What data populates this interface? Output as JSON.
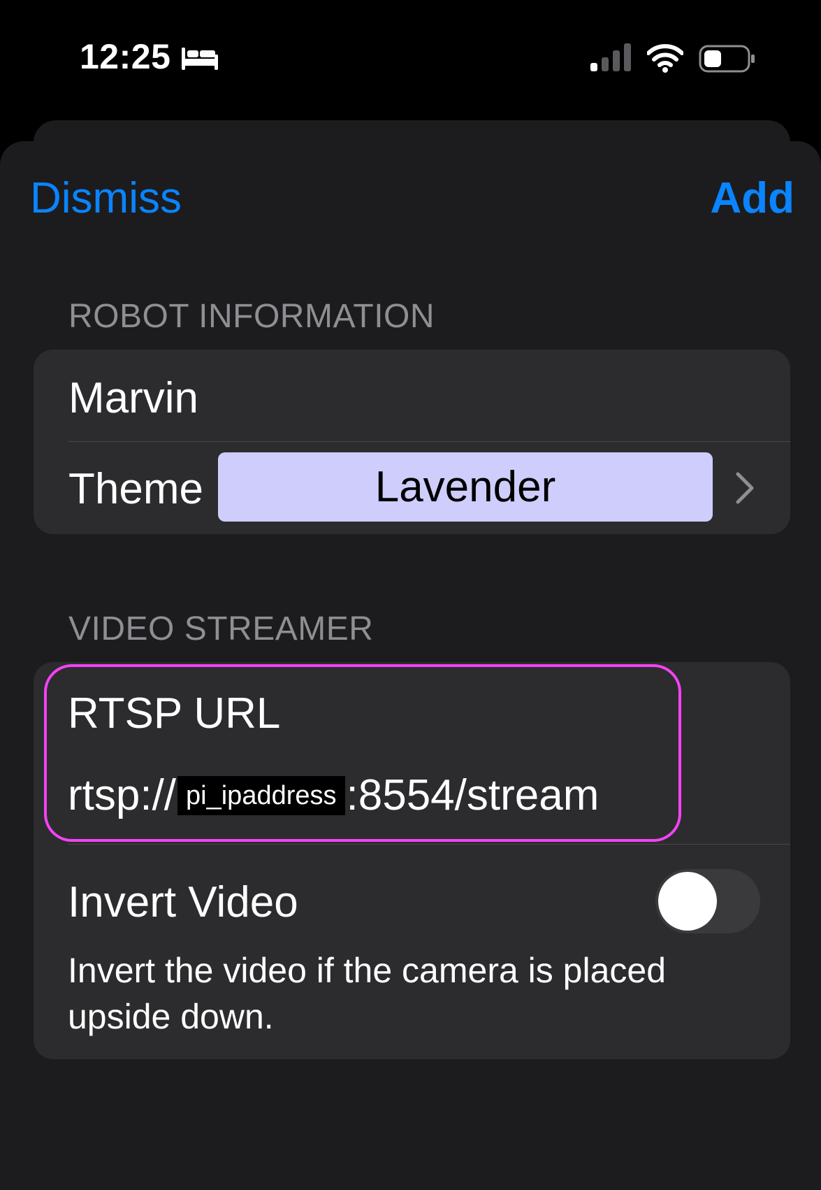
{
  "status_bar": {
    "time": "12:25",
    "focus_icon": "bed-icon",
    "signal_icon": "signal-icon",
    "wifi_icon": "wifi-icon",
    "battery_icon": "battery-icon"
  },
  "nav": {
    "dismiss_label": "Dismiss",
    "add_label": "Add",
    "accent_color": "#0a84ff"
  },
  "robot_information": {
    "header": "ROBOT INFORMATION",
    "name_value": "Marvin",
    "theme_label": "Theme",
    "theme_value": "Lavender",
    "theme_color": "#cfcdfb"
  },
  "video_streamer": {
    "header": "VIDEO STREAMER",
    "rtsp_label": "RTSP URL",
    "rtsp_prefix": "rtsp://",
    "rtsp_redacted": "pi_ipaddress",
    "rtsp_suffix": ":8554/stream",
    "invert_label": "Invert Video",
    "invert_enabled": false,
    "invert_footnote": "Invert the video if the camera is placed upside down.",
    "highlight_color": "#f542f5"
  }
}
